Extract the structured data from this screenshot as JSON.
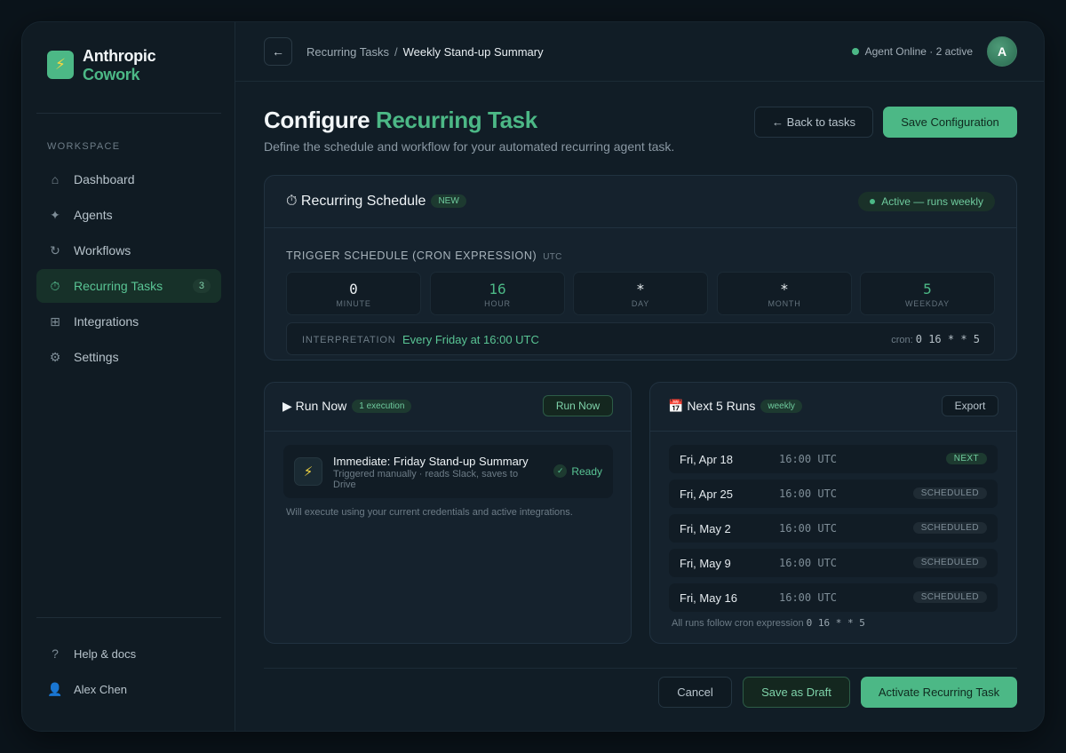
{
  "brand": {
    "name_line1": "Anthropic",
    "name_line2": "Cowork",
    "logo_icon": "bolt-icon"
  },
  "sidebar": {
    "section_label": "WORKSPACE",
    "items": [
      {
        "label": "Dashboard",
        "icon": "home-icon"
      },
      {
        "label": "Agents",
        "icon": "sparkle-icon"
      },
      {
        "label": "Workflows",
        "icon": "refresh-icon"
      },
      {
        "label": "Recurring Tasks",
        "icon": "timer-icon",
        "count": "3",
        "active": true
      },
      {
        "label": "Integrations",
        "icon": "grid-icon"
      },
      {
        "label": "Settings",
        "icon": "gear-icon"
      }
    ],
    "bottom": [
      {
        "label": "Help & docs",
        "icon": "help-icon"
      },
      {
        "label": "Alex Chen",
        "icon": "user-icon"
      }
    ]
  },
  "topbar": {
    "back_icon": "arrow-left-icon",
    "breadcrumb_parent": "Recurring Tasks",
    "breadcrumb_sep": "/",
    "breadcrumb_current": "Weekly Stand-up Summary",
    "agent_status": "Agent Online · 2 active",
    "avatar_initial": "A"
  },
  "page": {
    "title_main": "Configure",
    "title_accent": "Recurring Task",
    "subtitle": "Define the schedule and workflow for your automated recurring agent task.",
    "back_button": "← Back to tasks",
    "save_button": "Save Configuration"
  },
  "schedule": {
    "title": "⏱ Recurring Schedule",
    "badge": "NEW",
    "status": "Active — runs weekly",
    "trigger_label": "TRIGGER SCHEDULE (CRON EXPRESSION)",
    "timezone": "UTC",
    "fields": [
      {
        "value": "0",
        "label": "MINUTE"
      },
      {
        "value": "16",
        "label": "HOUR"
      },
      {
        "value": "*",
        "label": "DAY"
      },
      {
        "value": "*",
        "label": "MONTH"
      },
      {
        "value": "5",
        "label": "WEEKDAY"
      }
    ],
    "interpretation_label": "INTERPRETATION",
    "interpretation": "Every Friday at 16:00 UTC",
    "cron_prefix": "cron:",
    "cron": "0 16 * * 5"
  },
  "run_now": {
    "title": "▶ Run Now",
    "badge": "1 execution",
    "button": "Run Now",
    "task_title": "Immediate: Friday Stand-up Summary",
    "task_sub": "Triggered manually · reads Slack, saves to Drive",
    "status": "Ready",
    "note": "Will execute using your current credentials and active integrations."
  },
  "next_runs": {
    "title": "📅 Next 5 Runs",
    "badge": "weekly",
    "export": "Export",
    "runs": [
      {
        "date": "Fri, Apr 18",
        "time": "16:00 UTC",
        "status": "NEXT"
      },
      {
        "date": "Fri, Apr 25",
        "time": "16:00 UTC",
        "status": "SCHEDULED"
      },
      {
        "date": "Fri, May 2",
        "time": "16:00 UTC",
        "status": "SCHEDULED"
      },
      {
        "date": "Fri, May 9",
        "time": "16:00 UTC",
        "status": "SCHEDULED"
      },
      {
        "date": "Fri, May 16",
        "time": "16:00 UTC",
        "status": "SCHEDULED"
      }
    ],
    "note_prefix": "All runs follow cron expression",
    "note_cron": "0 16 * * 5"
  },
  "footer": {
    "cancel": "Cancel",
    "draft": "Save as Draft",
    "activate": "Activate Recurring Task"
  },
  "colors": {
    "accent": "#4cb886",
    "background": "#0b141b",
    "panel": "#15222d"
  }
}
